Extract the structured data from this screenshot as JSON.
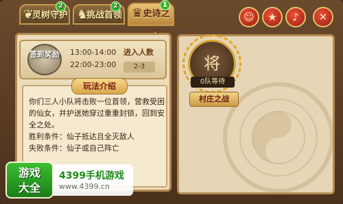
{
  "tabs": [
    {
      "label": "灵树守护",
      "badge": "2",
      "active": false,
      "icon": "tree-icon"
    },
    {
      "label": "挑战首领",
      "badge": "2",
      "active": false,
      "icon": "dragon-icon"
    },
    {
      "label": "史诗之战",
      "badge": "1",
      "active": true,
      "icon": "phoenix-icon"
    }
  ],
  "top_buttons": [
    {
      "name": "hero-button",
      "glyph": "☺"
    },
    {
      "name": "rank-button",
      "glyph": "★"
    },
    {
      "name": "sound-button",
      "glyph": "♪"
    },
    {
      "name": "close-button",
      "glyph": "✕"
    }
  ],
  "schedule": {
    "seal_text": "签到奖励",
    "times": [
      "13:00-14:00",
      "22:00-23:00"
    ],
    "enter_title": "进入人数",
    "enter_count": "2-3"
  },
  "intro": {
    "title": "玩法介绍",
    "body": "你们三人小队将击败一位首领，营救受困的仙女，并护送她穿过重重封锁，回到安全之处。",
    "win": "胜利条件：仙子抵达且全灭敌人",
    "lose": "失败条件：仙子或自己阵亡"
  },
  "battle": {
    "hero_glyph": "将",
    "queue_status": "0队等待",
    "map_name": "村庄之战"
  },
  "watermark": {
    "logo": "游戏大全",
    "site": "4399手机游戏",
    "url": "www.4399.cn"
  }
}
